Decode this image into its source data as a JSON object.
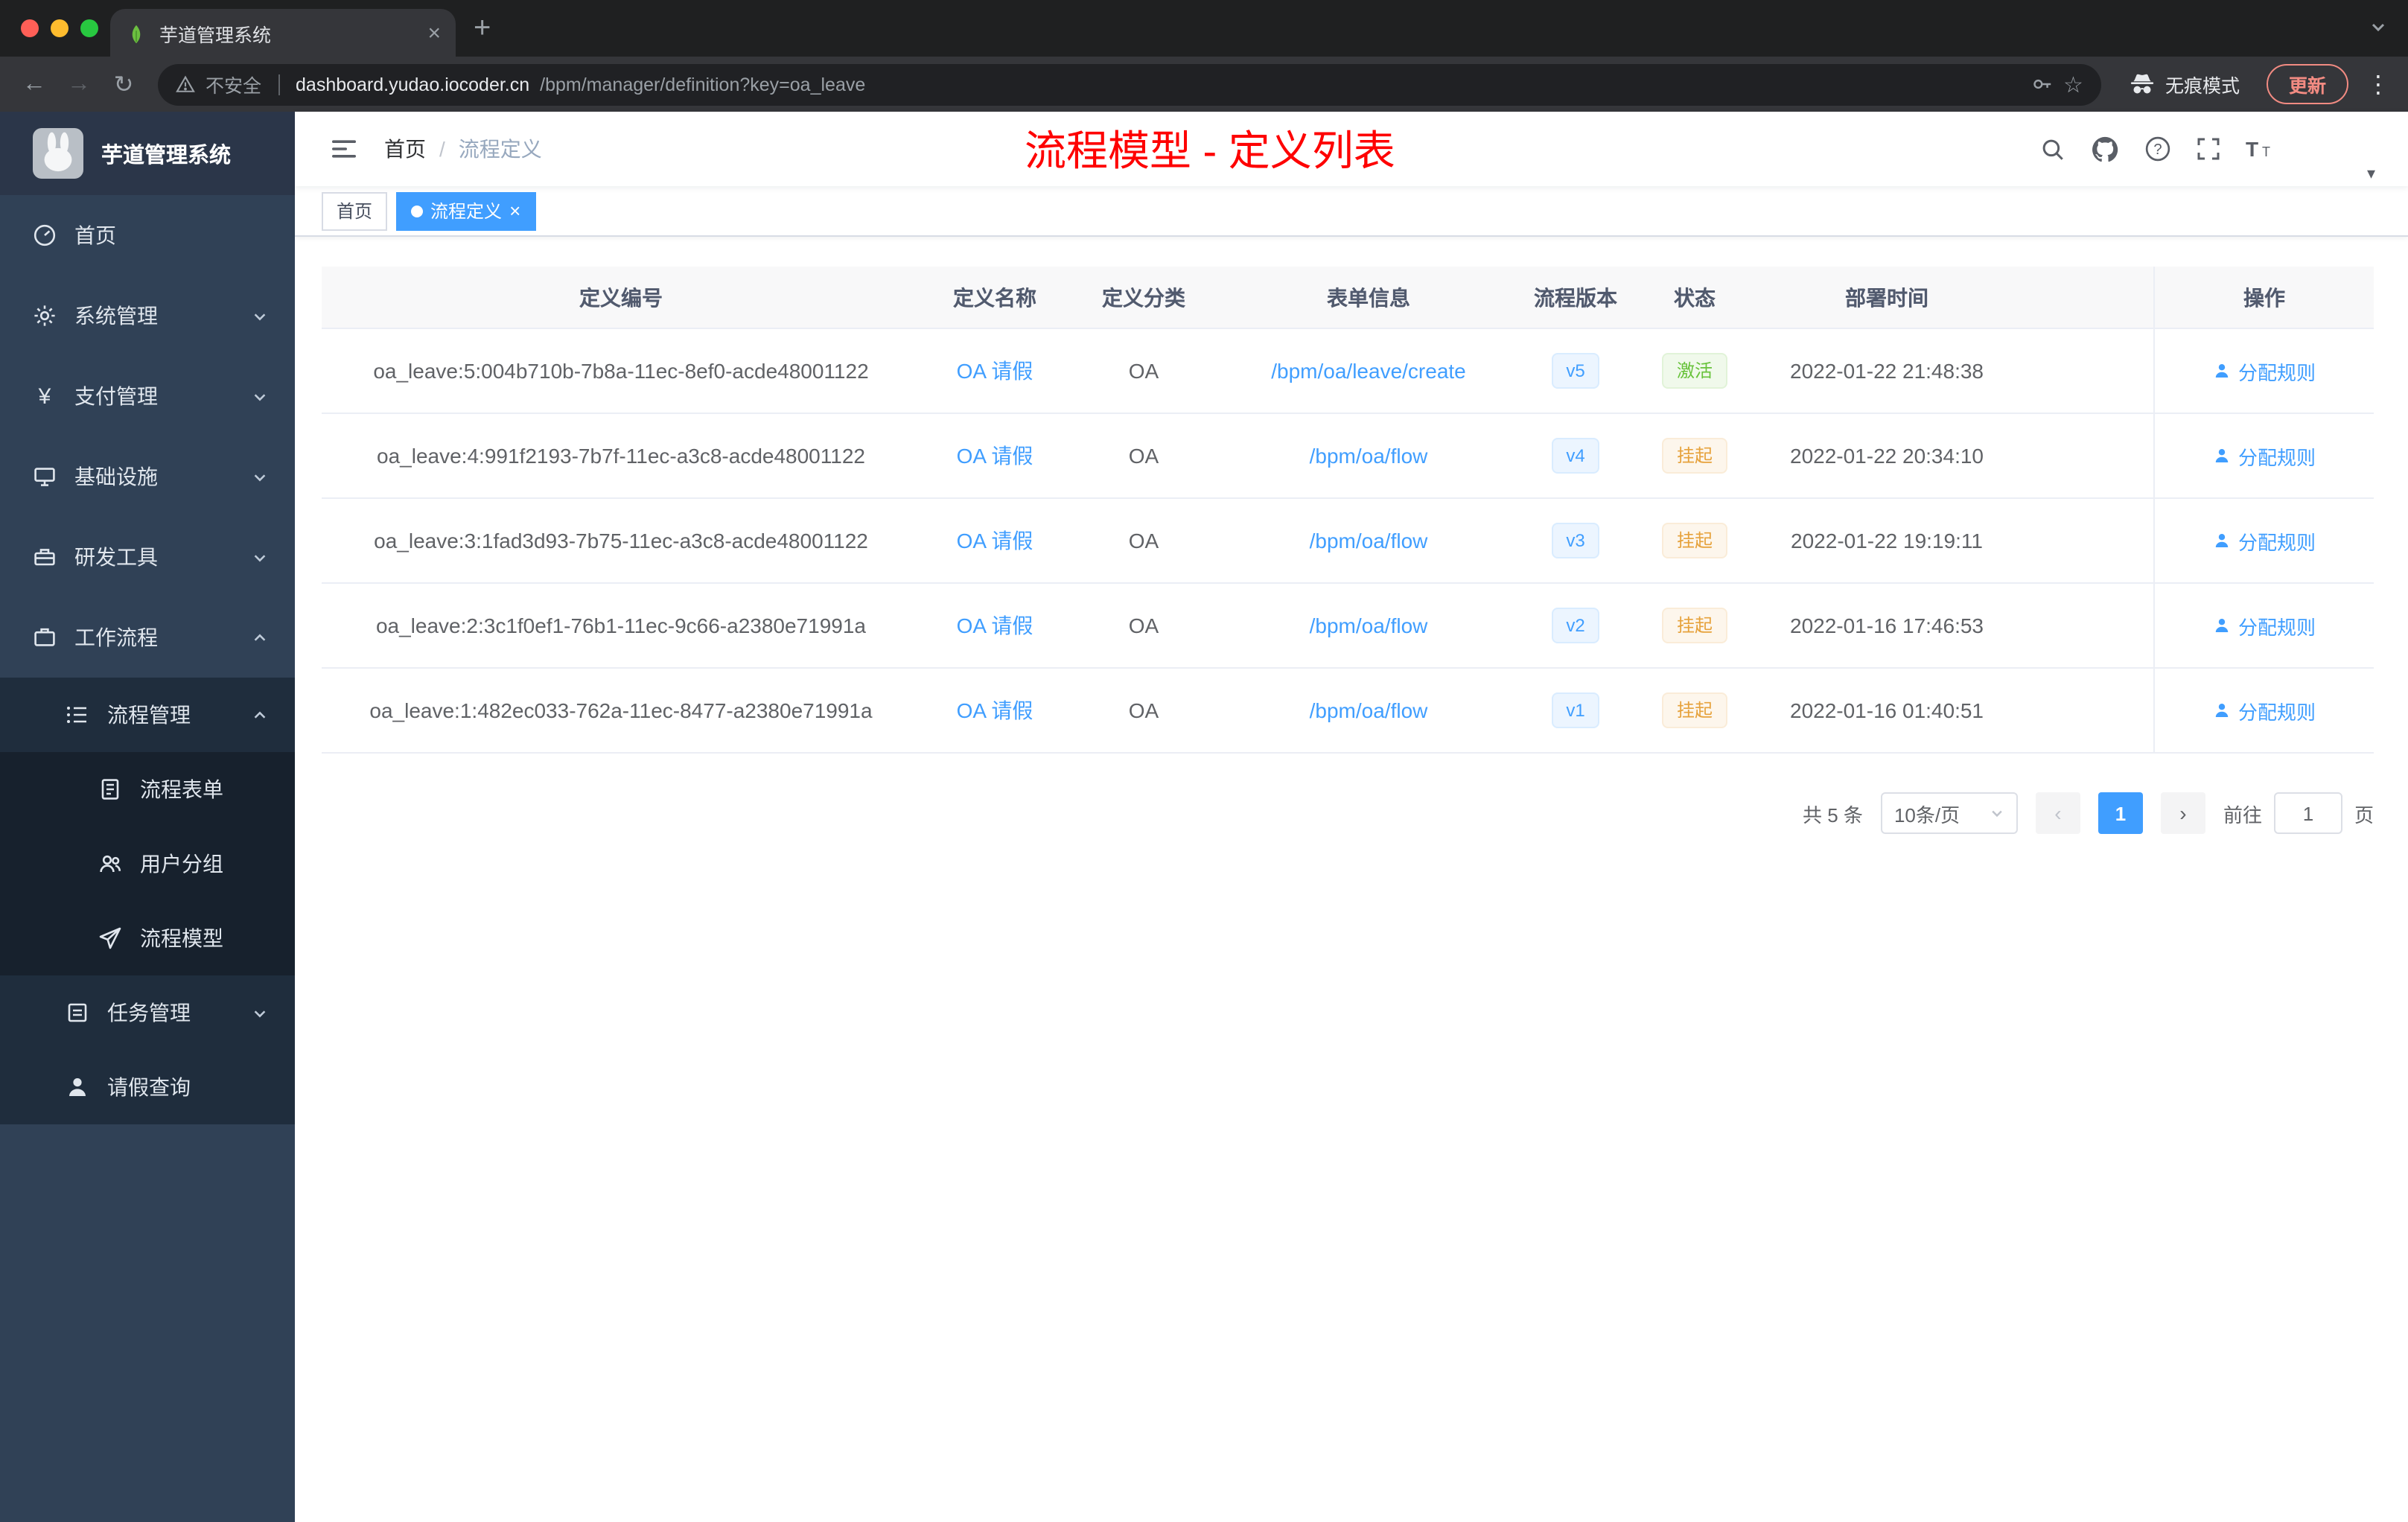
{
  "browser": {
    "tab_title": "芋道管理系统",
    "close_glyph": "×",
    "new_tab_glyph": "+",
    "back_glyph": "←",
    "forward_glyph": "→",
    "reload_glyph": "↻",
    "security_label": "不安全",
    "url_domain": "dashboard.yudao.iocoder.cn",
    "url_path": "/bpm/manager/definition?key=oa_leave",
    "star_glyph": "☆",
    "incognito_label": "无痕模式",
    "update_label": "更新",
    "menu_glyph": "⋮",
    "avatar_caret_glyph": "▾"
  },
  "sidebar": {
    "logo_title": "芋道管理系统",
    "yen_glyph": "¥",
    "menu": [
      {
        "label": "首页"
      },
      {
        "label": "系统管理"
      },
      {
        "label": "支付管理"
      },
      {
        "label": "基础设施"
      },
      {
        "label": "研发工具"
      },
      {
        "label": "工作流程"
      }
    ],
    "submenu": {
      "group": {
        "label": "流程管理"
      },
      "children": [
        {
          "label": "流程表单"
        },
        {
          "label": "用户分组"
        },
        {
          "label": "流程模型"
        }
      ],
      "task": {
        "label": "任务管理"
      },
      "leave": {
        "label": "请假查询"
      }
    }
  },
  "header": {
    "breadcrumb_home": "首页",
    "breadcrumb_sep": "/",
    "breadcrumb_current": "流程定义",
    "annotation": "流程模型 - 定义列表"
  },
  "tags": {
    "home": "首页",
    "current": "流程定义",
    "close_glyph": "×"
  },
  "table": {
    "columns": {
      "id": "定义编号",
      "name": "定义名称",
      "category": "定义分类",
      "form": "表单信息",
      "version": "流程版本",
      "status": "状态",
      "deploy_time": "部署时间",
      "actions": "操作"
    },
    "rows": [
      {
        "id": "oa_leave:5:004b710b-7b8a-11ec-8ef0-acde48001122",
        "name": "OA 请假",
        "category": "OA",
        "form": "/bpm/oa/leave/create",
        "version": "v5",
        "status": "激活",
        "deploy_time": "2022-01-22 21:48:38",
        "action": "分配规则"
      },
      {
        "id": "oa_leave:4:991f2193-7b7f-11ec-a3c8-acde48001122",
        "name": "OA 请假",
        "category": "OA",
        "form": "/bpm/oa/flow",
        "version": "v4",
        "status": "挂起",
        "deploy_time": "2022-01-22 20:34:10",
        "action": "分配规则"
      },
      {
        "id": "oa_leave:3:1fad3d93-7b75-11ec-a3c8-acde48001122",
        "name": "OA 请假",
        "category": "OA",
        "form": "/bpm/oa/flow",
        "version": "v3",
        "status": "挂起",
        "deploy_time": "2022-01-22 19:19:11",
        "action": "分配规则"
      },
      {
        "id": "oa_leave:2:3c1f0ef1-76b1-11ec-9c66-a2380e71991a",
        "name": "OA 请假",
        "category": "OA",
        "form": "/bpm/oa/flow",
        "version": "v2",
        "status": "挂起",
        "deploy_time": "2022-01-16 17:46:53",
        "action": "分配规则"
      },
      {
        "id": "oa_leave:1:482ec033-762a-11ec-8477-a2380e71991a",
        "name": "OA 请假",
        "category": "OA",
        "form": "/bpm/oa/flow",
        "version": "v1",
        "status": "挂起",
        "deploy_time": "2022-01-16 01:40:51",
        "action": "分配规则"
      }
    ]
  },
  "pagination": {
    "total": "共 5 条",
    "page_size": "10条/页",
    "prev_glyph": "‹",
    "page": "1",
    "next_glyph": "›",
    "goto_label": "前往",
    "goto_value": "1",
    "page_unit": "页"
  },
  "colors": {
    "primary": "#409eff",
    "status_active": "#67c23a",
    "status_suspended": "#e6a23c",
    "annotation_red": "#fe0000",
    "sidebar_bg": "#304156",
    "submenu_bg": "#1f2d3d"
  }
}
